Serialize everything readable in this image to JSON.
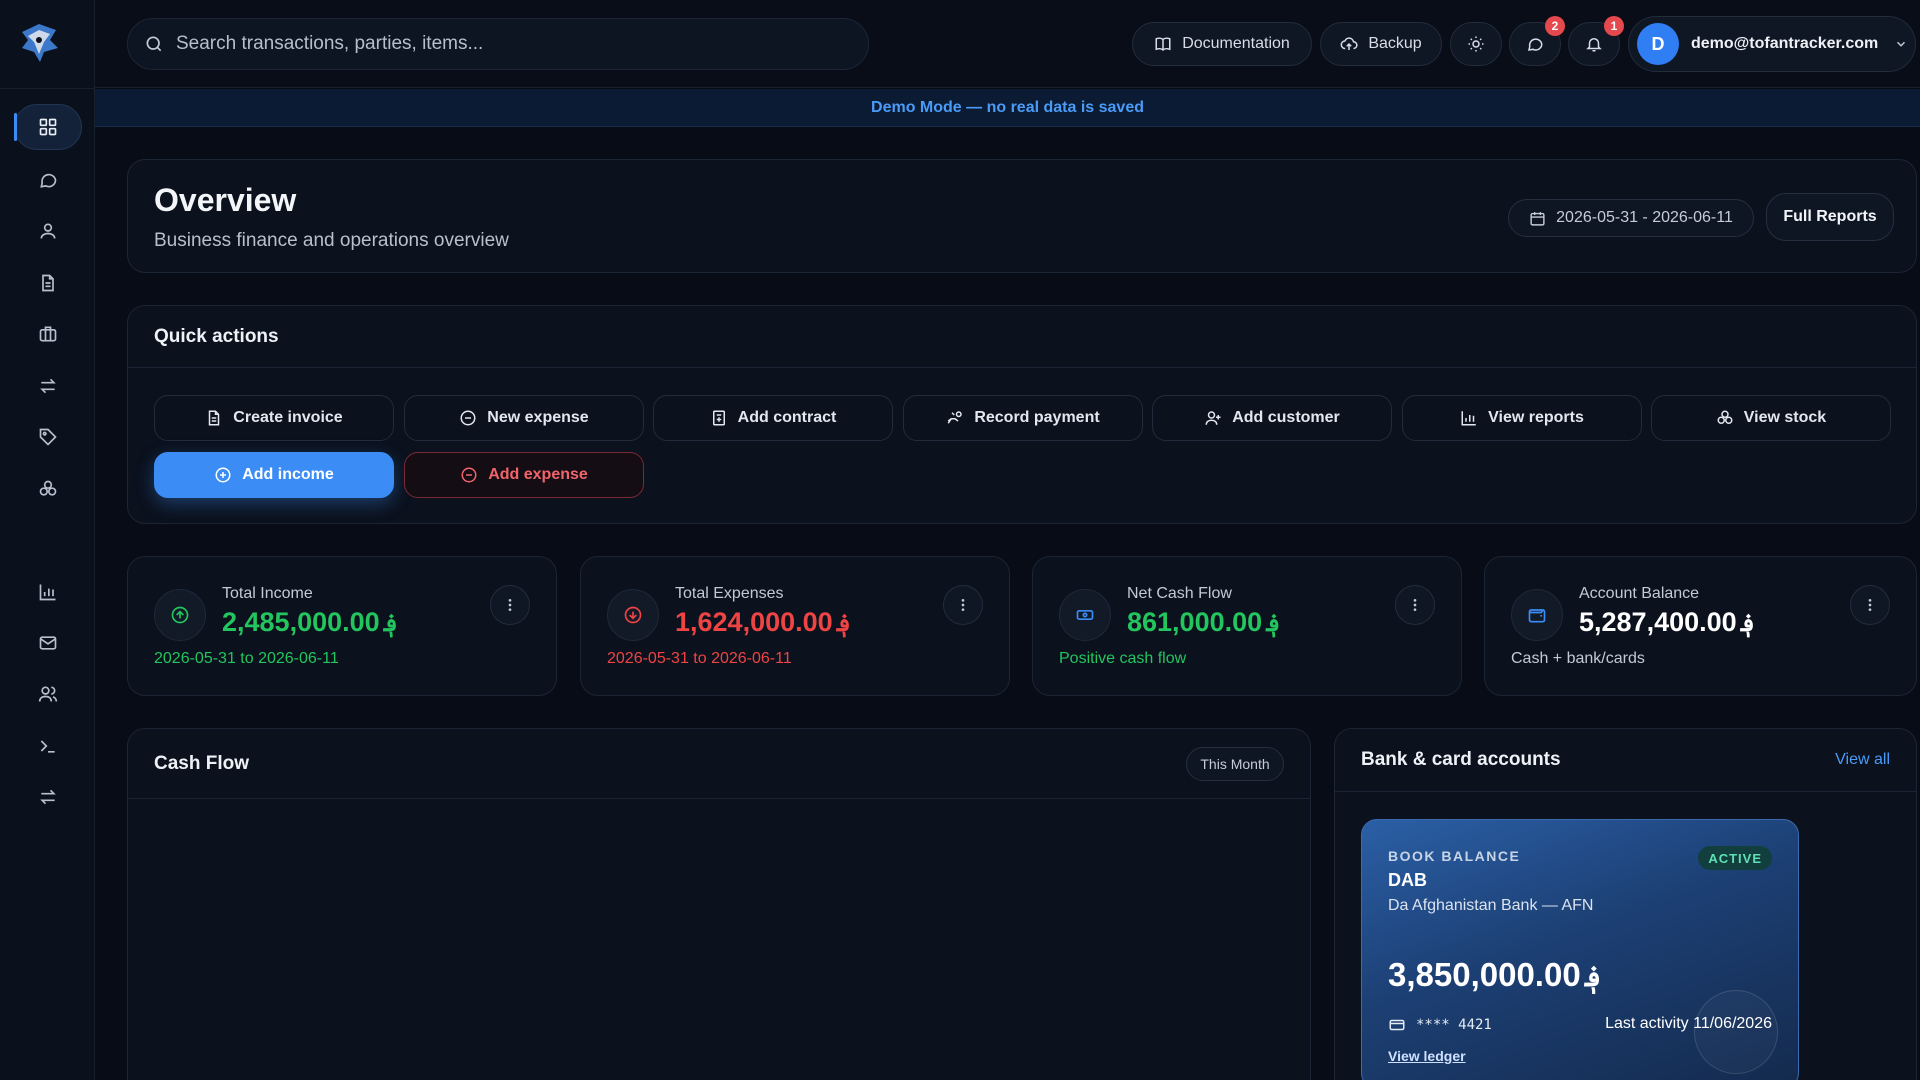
{
  "topbar": {
    "search_placeholder": "Search transactions, parties, items...",
    "documentation_label": "Documentation",
    "backup_label": "Backup",
    "messages_badge": "2",
    "notifications_badge": "1",
    "user_initial": "D",
    "user_email": "demo@tofantracker.com"
  },
  "banner": {
    "text": "Demo Mode — no real data is saved"
  },
  "overview": {
    "title": "Overview",
    "subtitle": "Business finance and operations overview",
    "date_range": "2026-05-31 - 2026-06-11",
    "full_reports_label": "Full Reports"
  },
  "quick_actions": {
    "title": "Quick actions",
    "buttons": [
      {
        "label": "Create invoice",
        "icon": "file-text-icon"
      },
      {
        "label": "New expense",
        "icon": "minus-circle-icon"
      },
      {
        "label": "Add contract",
        "icon": "contract-icon"
      },
      {
        "label": "Record payment",
        "icon": "hand-coins-icon"
      },
      {
        "label": "Add customer",
        "icon": "user-plus-icon"
      },
      {
        "label": "View reports",
        "icon": "bar-chart-icon"
      },
      {
        "label": "View stock",
        "icon": "boxes-icon"
      }
    ],
    "add_income_label": "Add income",
    "add_expense_label": "Add expense"
  },
  "stats": [
    {
      "label": "Total Income",
      "value": "2,485,000.00",
      "currency": "؋",
      "note": "2026-05-31 to 2026-06-11",
      "color": "#22c55e"
    },
    {
      "label": "Total Expenses",
      "value": "1,624,000.00",
      "currency": "؋",
      "note": "2026-05-31 to 2026-06-11",
      "color": "#ef4444"
    },
    {
      "label": "Net Cash Flow",
      "value": "861,000.00",
      "currency": "؋",
      "note": "Positive cash flow",
      "color": "#22c55e"
    },
    {
      "label": "Account Balance",
      "value": "5,287,400.00",
      "currency": "؋",
      "note": "Cash + bank/cards",
      "color": "#ffffff"
    }
  ],
  "cash_flow": {
    "title": "Cash Flow",
    "filter": "This Month"
  },
  "bank_accounts": {
    "title": "Bank & card accounts",
    "view_all": "View all",
    "card": {
      "label": "BOOK BALANCE",
      "name": "DAB",
      "bank": "Da Afghanistan Bank — AFN",
      "status": "ACTIVE",
      "amount": "3,850,000.00",
      "currency": "؋",
      "card_number": "**** 4421",
      "last_activity": "Last activity 11/06/2026",
      "ledger_link": "View ledger"
    }
  },
  "colors": {
    "accent": "#3b8df5",
    "income": "#22c55e",
    "expense": "#ef4444"
  }
}
